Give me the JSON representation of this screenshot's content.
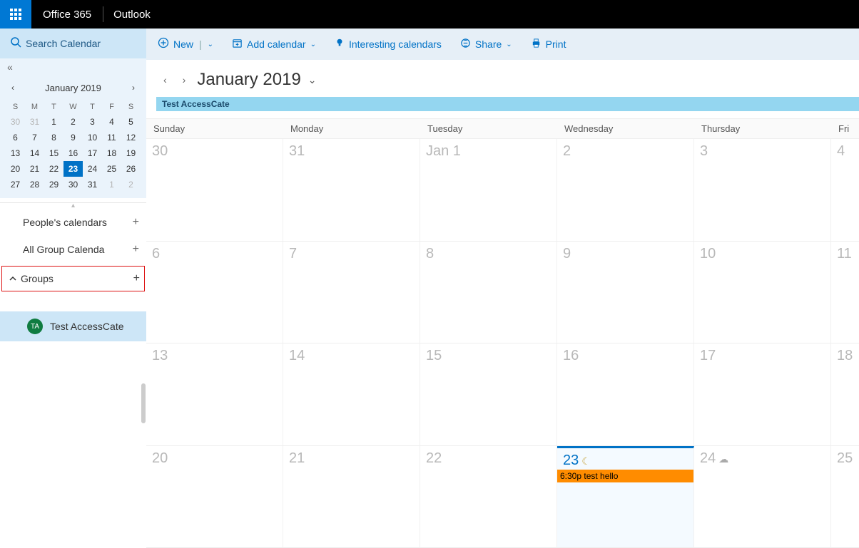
{
  "header": {
    "brand": "Office 365",
    "app": "Outlook"
  },
  "search": {
    "placeholder": "Search Calendar"
  },
  "miniCalendar": {
    "title": "January 2019",
    "dow": [
      "S",
      "M",
      "T",
      "W",
      "T",
      "F",
      "S"
    ],
    "weeks": [
      [
        "30",
        "31",
        "1",
        "2",
        "3",
        "4",
        "5"
      ],
      [
        "6",
        "7",
        "8",
        "9",
        "10",
        "11",
        "12"
      ],
      [
        "13",
        "14",
        "15",
        "16",
        "17",
        "18",
        "19"
      ],
      [
        "20",
        "21",
        "22",
        "23",
        "24",
        "25",
        "26"
      ],
      [
        "27",
        "28",
        "29",
        "30",
        "31",
        "1",
        "2"
      ]
    ],
    "otherMonth": [
      [
        0,
        1
      ],
      [
        5,
        5
      ],
      [
        5,
        6
      ]
    ],
    "today": [
      3,
      3
    ]
  },
  "sidebar": {
    "peoples": "People's calendars",
    "allGroup": "All Group Calenda",
    "groups": "Groups",
    "groupEntry": {
      "initials": "TA",
      "name": "Test AccessCate"
    }
  },
  "toolbar": {
    "new": "New",
    "addCal": "Add calendar",
    "interesting": "Interesting calendars",
    "share": "Share",
    "print": "Print"
  },
  "calendar": {
    "title": "January 2019",
    "tag": "Test AccessCate",
    "dayHeaders": [
      "Sunday",
      "Monday",
      "Tuesday",
      "Wednesday",
      "Thursday",
      "Fri"
    ],
    "weeks": [
      {
        "days": [
          "30",
          "31",
          "Jan 1",
          "2",
          "3",
          "4"
        ]
      },
      {
        "days": [
          "6",
          "7",
          "8",
          "9",
          "10",
          "11"
        ]
      },
      {
        "days": [
          "13",
          "14",
          "15",
          "16",
          "17",
          "18"
        ]
      },
      {
        "days": [
          "20",
          "21",
          "22",
          "23",
          "24",
          "25"
        ]
      }
    ],
    "today": {
      "week": 3,
      "col": 3
    },
    "weather": [
      {
        "week": 3,
        "col": 3,
        "icon": "moon"
      },
      {
        "week": 3,
        "col": 4,
        "icon": "cloud"
      }
    ],
    "events": [
      {
        "week": 3,
        "col": 3,
        "label": "6:30p test hello"
      }
    ]
  }
}
